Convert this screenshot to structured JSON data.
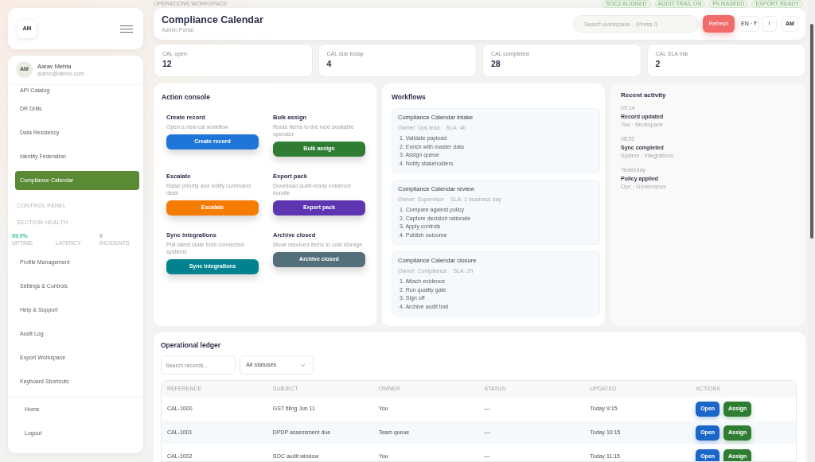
{
  "sidebar": {
    "brand": {
      "initials": "AM"
    },
    "user": {
      "initials": "AM",
      "name": "Aarav Mehta",
      "email": "admin@demo.com"
    },
    "nav_items": [
      {
        "label": "API Catalog",
        "selected": false
      },
      {
        "label": "DR Drills",
        "selected": false
      },
      {
        "label": "Data Residency",
        "selected": false
      },
      {
        "label": "Identity Federation",
        "selected": false
      },
      {
        "label": "Compliance Calendar",
        "selected": true
      }
    ],
    "control_panel_title": "CONTROL PANEL",
    "section_health": {
      "title": "SECTION HEALTH",
      "metrics": [
        {
          "value": "99.9%",
          "label": "UPTIME",
          "kind": "good"
        },
        {
          "label": "LATENCY"
        },
        {
          "value": "0",
          "label": "INCIDENTS",
          "kind": "neutral"
        }
      ]
    },
    "tool_items": [
      {
        "label": "Profile Management",
        "selected": false
      },
      {
        "label": "Settings & Controls",
        "selected": false
      },
      {
        "label": "Help & Support",
        "selected": false
      },
      {
        "label": "Audit Log",
        "selected": false
      },
      {
        "label": "Export Workspace",
        "selected": false
      },
      {
        "label": "Keyboard Shortcuts",
        "selected": false
      }
    ],
    "footer_links": [
      "Home",
      "Logout"
    ]
  },
  "header": {
    "eyebrow": "OPERATIONS WORKSPACE",
    "badges": [
      "SOC2 ALIGNED",
      "AUDIT TRAIL ON",
      "PII MASKED",
      "EXPORT READY"
    ],
    "title": "Compliance Calendar",
    "subtitle": "Admin Portal",
    "search": {
      "placeholder": "Search workspace... (Press /)"
    },
    "refresh": "Refresh",
    "locale": "EN · ₹",
    "alert": "!",
    "avatar": "AM"
  },
  "stats": [
    {
      "label": "CAL open",
      "value": "12"
    },
    {
      "label": "CAL due today",
      "value": "4"
    },
    {
      "label": "CAL completed",
      "value": "28"
    },
    {
      "label": "CAL SLA risk",
      "value": "2"
    }
  ],
  "action_console": {
    "title": "Action console",
    "actions": [
      {
        "title": "Create record",
        "description": "Open a new cal workflow",
        "button": "Create record",
        "color": "#1f74d8"
      },
      {
        "title": "Bulk assign",
        "description": "Route items to the next available operator",
        "button": "Bulk assign",
        "color": "#2e7d32"
      },
      {
        "title": "Escalate",
        "description": "Raise priority and notify command desk",
        "button": "Escalate",
        "color": "#f57c00"
      },
      {
        "title": "Export pack",
        "description": "Download audit-ready evidence bundle",
        "button": "Export pack",
        "color": "#5e35b1"
      },
      {
        "title": "Sync integrations",
        "description": "Pull latest state from connected systems",
        "button": "Sync integrations",
        "color": "#00838f"
      },
      {
        "title": "Archive closed",
        "description": "Move resolved items to cold storage",
        "button": "Archive closed",
        "color": "#546e7a"
      }
    ]
  },
  "workflows": {
    "title": "Workflows",
    "items": [
      {
        "title": "Compliance Calendar intake",
        "owner": "Owner: Ops lead",
        "sla": "SLA: 4h",
        "steps": [
          "1. Validate payload",
          "2. Enrich with master data",
          "3. Assign queue",
          "4. Notify stakeholders"
        ]
      },
      {
        "title": "Compliance Calendar review",
        "owner": "Owner: Supervisor",
        "sla": "SLA: 1 business day",
        "steps": [
          "1. Compare against policy",
          "2. Capture decision rationale",
          "3. Apply controls",
          "4. Publish outcome"
        ]
      },
      {
        "title": "Compliance Calendar closure",
        "owner": "Owner: Compliance",
        "sla": "SLA: 2h",
        "steps": [
          "1. Attach evidence",
          "2. Run quality gate",
          "3. Sign off",
          "4. Archive audit trail"
        ]
      }
    ]
  },
  "recent_activity": {
    "title": "Recent activity",
    "entries": [
      {
        "time": "09:14",
        "title": "Record updated",
        "meta": "You · Workspace"
      },
      {
        "time": "08:52",
        "title": "Sync completed",
        "meta": "System · Integrations"
      },
      {
        "time": "Yesterday",
        "title": "Policy applied",
        "meta": "Ops · Governance"
      }
    ]
  },
  "ledger": {
    "title": "Operational ledger",
    "search": {
      "placeholder": "Search records..."
    },
    "status_filter": {
      "value": "All statuses"
    },
    "columns": [
      "REFERENCE",
      "SUBJECT",
      "OWNER",
      "STATUS",
      "UPDATED",
      "ACTIONS"
    ],
    "rows": [
      {
        "reference": "CAL-1000",
        "subject": "GST filing Jun 11",
        "owner": "You",
        "status": "—",
        "updated": "Today 9:15",
        "actions": [
          {
            "label": "Open",
            "kind": "primary"
          },
          {
            "label": "Assign",
            "kind": "success"
          }
        ]
      },
      {
        "reference": "CAL-1001",
        "subject": "DPDP assessment due",
        "owner": "Team queue",
        "status": "—",
        "updated": "Today 10:15",
        "actions": [
          {
            "label": "Open",
            "kind": "primary"
          },
          {
            "label": "Assign",
            "kind": "success"
          }
        ]
      },
      {
        "reference": "CAL-1002",
        "subject": "SOC audit window",
        "owner": "You",
        "status": "—",
        "updated": "Today 11:15",
        "actions": [
          {
            "label": "Open",
            "kind": "primary"
          },
          {
            "label": "Assign",
            "kind": "success"
          }
        ]
      }
    ]
  }
}
